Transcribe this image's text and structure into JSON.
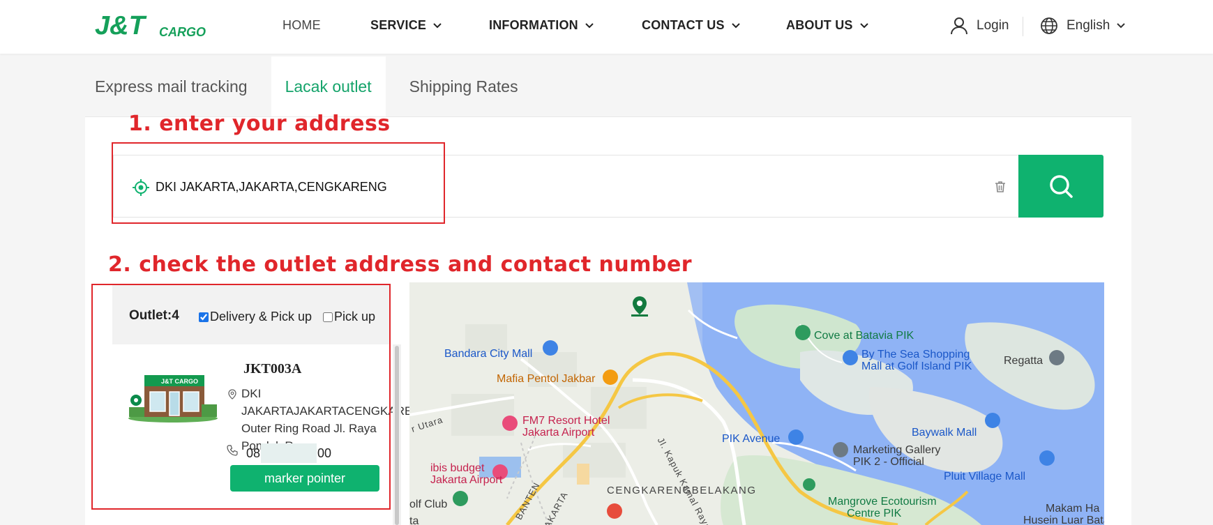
{
  "brand": {
    "name": "J&T CARGO",
    "logo_main": "J&T",
    "logo_sub": "CARGO",
    "accent_color": "#0fb26f",
    "annotation_color": "#e0262b"
  },
  "nav": {
    "home": "HOME",
    "service": "SERVICE",
    "information": "INFORMATION",
    "contact": "CONTACT US",
    "about": "ABOUT US",
    "login": "Login",
    "language": "English"
  },
  "tabs": [
    {
      "label": "Express mail tracking",
      "active": false
    },
    {
      "label": "Lacak outlet",
      "active": true
    },
    {
      "label": "Shipping Rates",
      "active": false
    }
  ],
  "annotations": {
    "step1": "1. enter your address",
    "step2": "2. check the outlet address and contact number"
  },
  "search": {
    "value": "DKI JAKARTA,JAKARTA,CENGKARENG",
    "icon": "search-icon"
  },
  "outlets": {
    "count_label": "Outlet:4",
    "filters": [
      {
        "label": "Delivery & Pick up",
        "checked": true
      },
      {
        "label": "Pick up",
        "checked": false
      }
    ],
    "items": [
      {
        "code": "JKT003A",
        "address": "DKI JAKARTAJAKARTACENGKARENGJkt Outer Ring Road Jl. Raya Pondok R...",
        "phone_prefix": "08",
        "phone_suffix": "00",
        "button": "marker pointer"
      }
    ]
  },
  "map": {
    "labels": {
      "cove": "Cove at Batavia PIK",
      "bandara": "Bandara City Mall",
      "sea_shopping_1": "By The Sea Shopping",
      "sea_shopping_2": "Mall at Golf Island PIK",
      "regatta": "Regatta",
      "mafia": "Mafia Pentol Jakbar",
      "fm7_1": "FM7 Resort Hotel",
      "fm7_2": "Jakarta Airport",
      "utara": "r Utara",
      "kapuk": "Jl. Kapuk Kamal Raya",
      "baywalk": "Baywalk Mall",
      "pik_avenue": "PIK Avenue",
      "marketing_1": "Marketing Gallery",
      "marketing_2": "PIK 2 - Official",
      "ibis_1": "ibis budget",
      "ibis_2": "Jakarta Airport",
      "banten": "BANTEN",
      "jakarta": "JAKARTA",
      "pluit": "Pluit Village Mall",
      "cengkareng": "CENGKARENGBELAKANG",
      "golf": "olf Club",
      "mangrove_1": "Mangrove Ecotourism",
      "mangrove_2": "Centre PIK",
      "makam_1": "Makam Ha",
      "makam_2": "Husein Luar Bata",
      "ta": "ta"
    }
  }
}
